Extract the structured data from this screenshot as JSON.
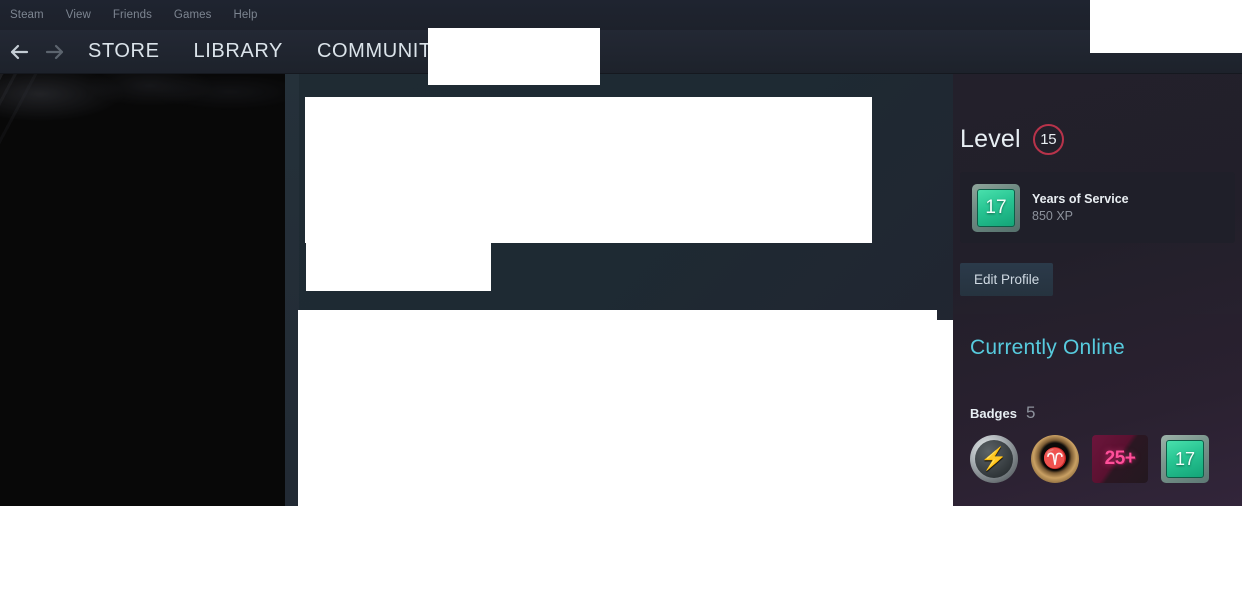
{
  "client": {
    "menubar": [
      {
        "label": "Steam",
        "name": "menu-steam"
      },
      {
        "label": "View",
        "name": "menu-view"
      },
      {
        "label": "Friends",
        "name": "menu-friends"
      },
      {
        "label": "Games",
        "name": "menu-games"
      },
      {
        "label": "Help",
        "name": "menu-help"
      }
    ],
    "nav": {
      "back_icon": "arrow-left-icon",
      "forward_icon": "arrow-right-icon",
      "links": [
        {
          "label": "STORE",
          "name": "nav-store"
        },
        {
          "label": "LIBRARY",
          "name": "nav-library"
        },
        {
          "label": "COMMUNITY",
          "name": "nav-community"
        }
      ]
    }
  },
  "profile": {
    "level": {
      "label": "Level",
      "value": "15",
      "ring_color": "#b8334a"
    },
    "featured_badge": {
      "icon_value": "17",
      "title": "Years of Service",
      "xp": "850 XP"
    },
    "edit_profile_label": "Edit Profile",
    "status": {
      "text": "Currently Online",
      "color": "#57cbde"
    },
    "badges": {
      "label": "Badges",
      "count": "5",
      "items": [
        {
          "name": "badge-lightning-coin",
          "glyph": "⚡",
          "kind": "coin"
        },
        {
          "name": "badge-laurel-wreath",
          "glyph": "♈",
          "kind": "wreath"
        },
        {
          "name": "badge-25-plus",
          "glyph": "25+",
          "kind": "count"
        },
        {
          "name": "badge-years-of-service",
          "glyph": "17",
          "kind": "years"
        }
      ]
    }
  }
}
